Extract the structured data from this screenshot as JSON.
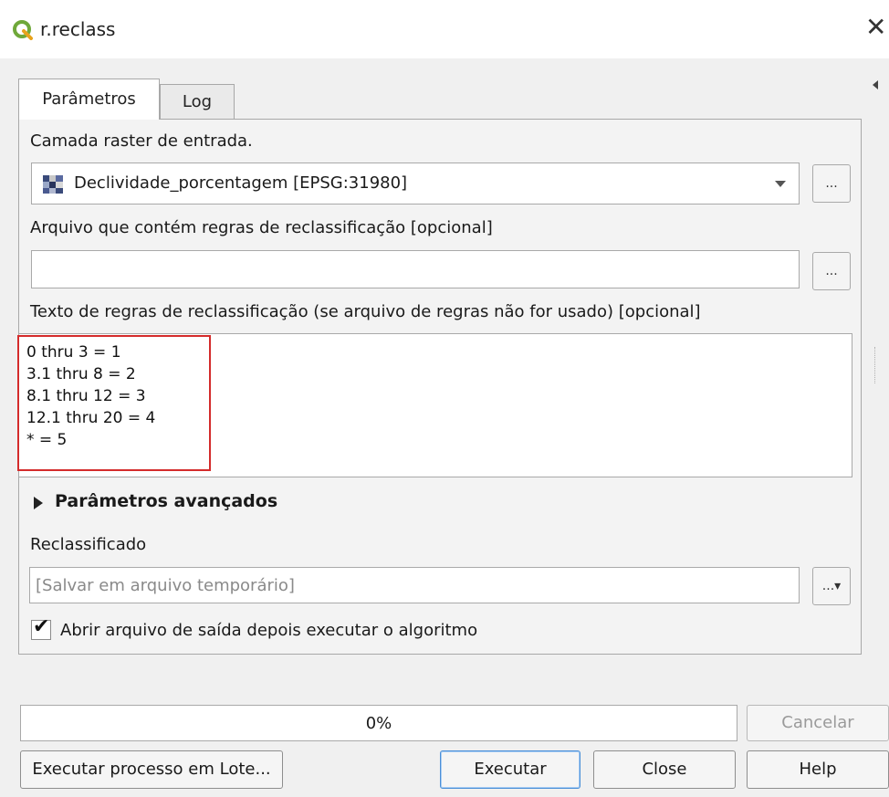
{
  "window": {
    "title": "r.reclass",
    "close_glyph": "✕",
    "icon": "qgis-logo"
  },
  "tabs": [
    {
      "label": "Parâmetros",
      "active": true
    },
    {
      "label": "Log",
      "active": false
    }
  ],
  "params": {
    "input_layer": {
      "label": "Camada raster de entrada.",
      "value": "Declividade_porcentagem [EPSG:31980]",
      "icon": "raster-layer-icon",
      "browse": "..."
    },
    "rules_file": {
      "label": "Arquivo que contém regras de reclassificação [opcional]",
      "value": "",
      "browse": "..."
    },
    "rules_text": {
      "label": "Texto de regras de reclassificação (se arquivo de regras não for usado) [opcional]",
      "value": "0 thru 3 = 1\n3.1 thru 8 = 2\n8.1 thru 12 = 3\n12.1 thru 20 = 4\n* = 5"
    },
    "advanced": {
      "label": "Parâmetros avançados"
    },
    "output": {
      "label": "Reclassificado",
      "placeholder": "[Salvar em arquivo temporário]",
      "browse": "...▾"
    },
    "open_output": {
      "label": "Abrir arquivo de saída depois executar o algoritmo",
      "checked": true
    }
  },
  "progress": {
    "text": "0%",
    "value": 0
  },
  "buttons": {
    "cancel": "Cancelar",
    "batch": "Executar processo em Lote...",
    "run": "Executar",
    "close": "Close",
    "help": "Help"
  },
  "colors": {
    "highlight_box": "#d42b2b",
    "default_button_border": "#4a8fd8"
  }
}
